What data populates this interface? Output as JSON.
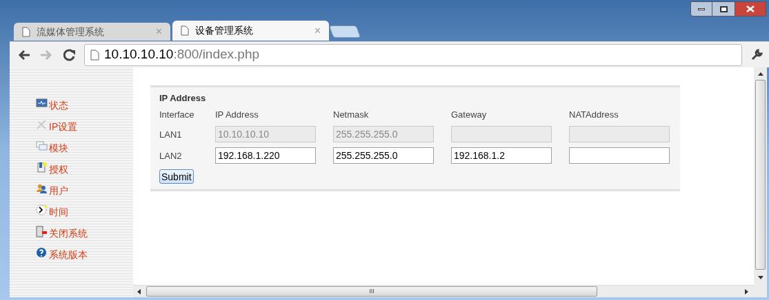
{
  "tabs": [
    {
      "title": "流媒体管理系统",
      "close": "×",
      "selected": false
    },
    {
      "title": "设备管理系统",
      "close": "×",
      "selected": true
    }
  ],
  "address_bar": {
    "host": "10.10.10.10",
    "path": ":800/index.php"
  },
  "sidebar": {
    "items": [
      {
        "label": "状态"
      },
      {
        "label": "IP设置"
      },
      {
        "label": "模块"
      },
      {
        "label": "授权"
      },
      {
        "label": "用户"
      },
      {
        "label": "时间"
      },
      {
        "label": "关闭系统"
      },
      {
        "label": "系统版本"
      }
    ]
  },
  "form": {
    "title": "IP Address",
    "columns": [
      "Interface",
      "IP Address",
      "Netmask",
      "Gateway",
      "NATAddress"
    ],
    "rows": [
      {
        "interface": "LAN1",
        "disabled": true,
        "values": [
          "10.10.10.10",
          "255.255.255.0"
        ]
      },
      {
        "interface": "LAN2",
        "disabled": false,
        "values": [
          "192.168.1.220",
          "255.255.255.0",
          "192.168.1.2"
        ]
      }
    ],
    "submit": "Submit"
  },
  "h_scrollbar": {
    "grip": "III"
  }
}
